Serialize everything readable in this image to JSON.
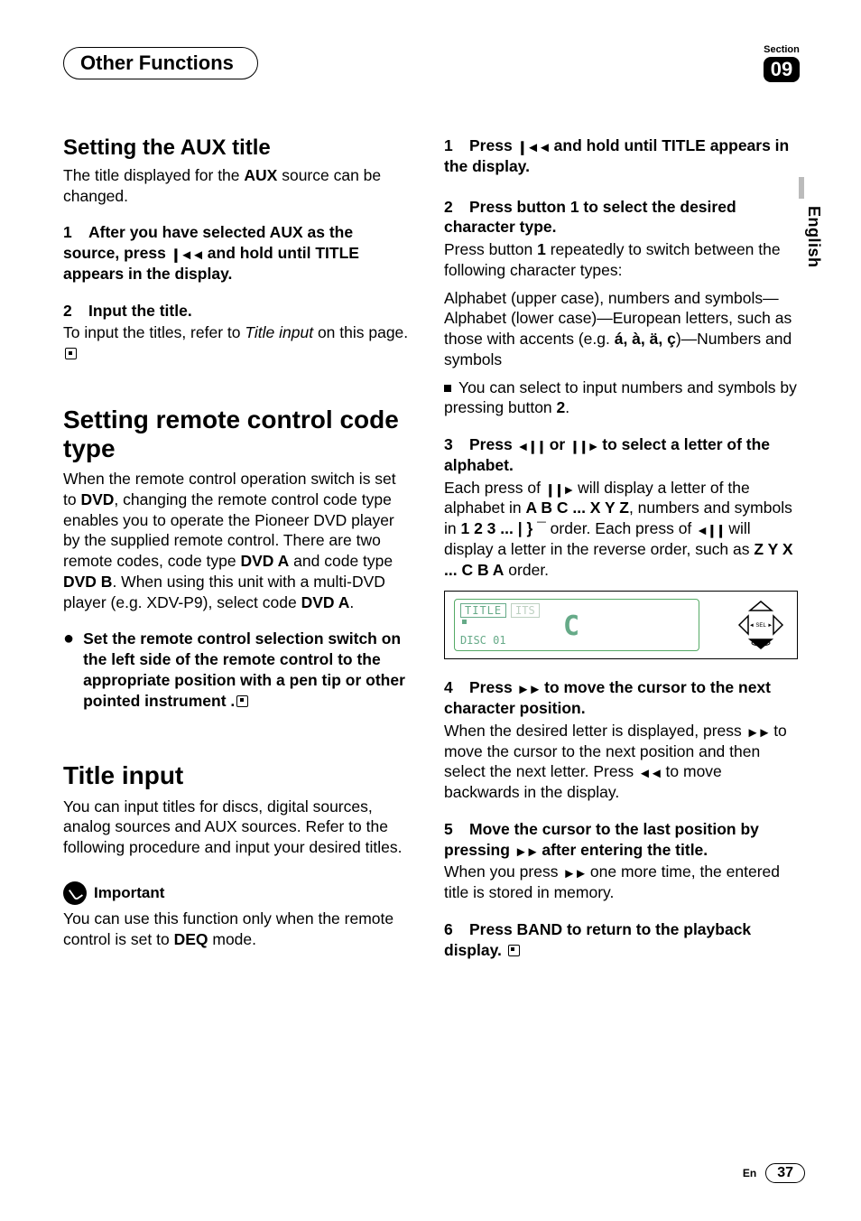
{
  "header": {
    "title": "Other Functions",
    "section_label": "Section",
    "section_number": "09"
  },
  "side_language": "English",
  "left": {
    "h2_aux": "Setting the AUX title",
    "aux_intro_a": "The title displayed for the ",
    "aux_intro_b": "AUX",
    "aux_intro_c": " source can be changed.",
    "aux_step1_head_a": "After you have selected AUX as the source, press ",
    "aux_step1_head_b": " and hold until TITLE appears in the display.",
    "aux_step2_head": "Input the title.",
    "aux_step2_body_a": "To input the titles, refer to ",
    "aux_step2_body_b": "Title input",
    "aux_step2_body_c": " on this page.",
    "h1_remote": "Setting remote control code type",
    "remote_body_a": "When the remote control operation switch is set to ",
    "remote_body_b": "DVD",
    "remote_body_c": ", changing the remote control code type enables you to operate the Pioneer DVD player by the supplied remote control. There are two remote codes, code type ",
    "remote_body_d": "DVD A",
    "remote_body_e": " and code type ",
    "remote_body_f": "DVD B",
    "remote_body_g": ". When using this unit with a multi-DVD player (e.g. XDV-P9), select code ",
    "remote_body_h": "DVD A",
    "remote_body_i": ".",
    "remote_bullet": "Set the remote control selection switch on the left side of the remote control to the appropriate position with a pen tip or other pointed instrument .",
    "h1_title": "Title input",
    "title_body": "You can input titles for discs, digital sources, analog sources and AUX sources. Refer to the following procedure and input your desired titles.",
    "important_label": "Important",
    "important_body_a": "You can use this function only when the remote control is set to ",
    "important_body_b": "DEQ",
    "important_body_c": " mode."
  },
  "right": {
    "s1_head_a": "Press ",
    "s1_head_b": " and hold until TITLE appears in the display.",
    "s2_head": "Press button 1 to select the desired character type.",
    "s2_body_a": "Press button ",
    "s2_body_b": "1",
    "s2_body_c": " repeatedly to switch between the following character types:",
    "s2_body_d": "Alphabet (upper case), numbers and symbols—Alphabet (lower case)—European letters, such as those with accents (e.g. ",
    "s2_body_e": "á, à, ä, ç",
    "s2_body_f": ")—Numbers and symbols",
    "s2_note_a": "You can select to input numbers and symbols by pressing button ",
    "s2_note_b": "2",
    "s2_note_c": ".",
    "s3_head_a": "Press ",
    "s3_head_b": " or ",
    "s3_head_c": " to select a letter of the alphabet.",
    "s3_body_a": "Each press of ",
    "s3_body_b": " will display a letter of the alphabet in ",
    "s3_body_c": "A B C ... X Y Z",
    "s3_body_d": ", numbers and symbols in ",
    "s3_body_e": "1 2 3 ... | } ¯",
    "s3_body_f": " order. Each press of ",
    "s3_body_g": " will display a letter in the reverse order, such as ",
    "s3_body_h": "Z Y X ... C B A",
    "s3_body_i": " order.",
    "lcd_title": "TITLE",
    "lcd_its": "ITS",
    "lcd_disc": "DISC 01",
    "lcd_big": "C",
    "lcd_sel": "SEL",
    "s4_head_a": "Press ",
    "s4_head_b": " to move the cursor to the next character position.",
    "s4_body_a": "When the desired letter is displayed, press ",
    "s4_body_b": " to move the cursor to the next position and then select the next letter. Press ",
    "s4_body_c": " to move backwards in the display.",
    "s5_head_a": "Move the cursor to the last position by pressing ",
    "s5_head_b": " after entering the title.",
    "s5_body_a": "When you press ",
    "s5_body_b": " one more time, the entered title is stored in memory.",
    "s6_head": "Press BAND to return to the playback display."
  },
  "footer": {
    "lang_code": "En",
    "page": "37"
  },
  "icons": {
    "prev_track": "❙◄◄",
    "left_pause": "◄❙❙",
    "right_pause": "❙❙►",
    "ffwd": "►►",
    "rew": "◄◄"
  }
}
